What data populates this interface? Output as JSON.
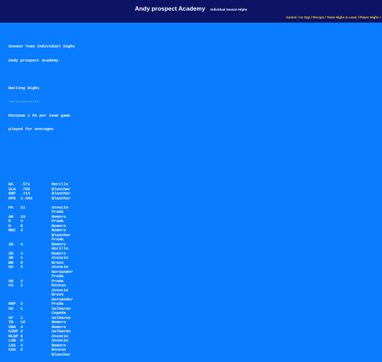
{
  "header": {
    "title": "Andy prospect Academy",
    "subtitle": "Individual Season Highs"
  },
  "nav": {
    "links": [
      "Games",
      "vs Opp",
      "Recaps",
      "Team Highs & Lows",
      "Player Highs"
    ],
    "separator": "/"
  },
  "content": {
    "heading1": "Season Team Individual Highs",
    "heading2": "Andy prospect Academy",
    "section": "Batting Highs",
    "underline": "-------------",
    "note1": "Minimum 1 PA per team game",
    "note2": "played for averages",
    "groups": [
      [
        {
          "stat": "BA",
          "value": ".571",
          "player": "Morillo"
        },
        {
          "stat": "SLG",
          "value": ".750",
          "player": "Blanchar"
        },
        {
          "stat": "OBP",
          "value": ".714",
          "player": "Blanchar"
        },
        {
          "stat": "OPS",
          "value": "1.464",
          "player": "Blanchar"
        }
      ],
      [
        {
          "stat": "PA",
          "value": "21",
          "player": "Atencio"
        },
        {
          "stat": "",
          "value": "",
          "player": "Prada"
        },
        {
          "stat": "AB",
          "value": "19",
          "player": "Romero"
        },
        {
          "stat": "R",
          "value": "4",
          "player": "Prada"
        },
        {
          "stat": "H",
          "value": "8",
          "player": "Romero"
        },
        {
          "stat": "RBI",
          "value": "3",
          "player": "Romero"
        },
        {
          "stat": "",
          "value": "",
          "player": "Blanchar"
        },
        {
          "stat": "",
          "value": "",
          "player": "Prada"
        },
        {
          "stat": "1B",
          "value": "4",
          "player": "Romero"
        },
        {
          "stat": "",
          "value": "",
          "player": "Morillo"
        },
        {
          "stat": "2B",
          "value": "4",
          "player": "Romero"
        },
        {
          "stat": "3B",
          "value": "1",
          "player": "Atencio"
        },
        {
          "stat": "BB",
          "value": "6",
          "player": "Bravo"
        },
        {
          "stat": "SO",
          "value": "5",
          "player": "Atencio"
        },
        {
          "stat": "",
          "value": "",
          "player": "Hernander"
        },
        {
          "stat": "",
          "value": "",
          "player": "Prada"
        },
        {
          "stat": "SB",
          "value": "2",
          "player": "Prada"
        },
        {
          "stat": "CS",
          "value": "1",
          "player": "Rincon"
        },
        {
          "stat": "",
          "value": "",
          "player": "Atencio"
        },
        {
          "stat": "",
          "value": "",
          "player": "Bravo"
        },
        {
          "stat": "",
          "value": "",
          "player": "Hernander"
        },
        {
          "stat": "HBP",
          "value": "3",
          "player": "Prada"
        },
        {
          "stat": "SH",
          "value": "1",
          "player": "Sulbaran"
        },
        {
          "stat": "",
          "value": "",
          "player": "Cepeda"
        },
        {
          "stat": "SF",
          "value": "1",
          "player": "Sulbaran"
        },
        {
          "stat": "TB",
          "value": "12",
          "player": "Romero"
        },
        {
          "stat": "XBH",
          "value": "4",
          "player": "Romero"
        },
        {
          "stat": "GIDP",
          "value": "2",
          "player": "Sulbaran"
        },
        {
          "stat": "RLSP",
          "value": "6",
          "player": "Atencio"
        },
        {
          "stat": "LOB",
          "value": "8",
          "player": "Atencio"
        },
        {
          "stat": "LHS",
          "value": "4",
          "player": "Romero"
        },
        {
          "stat": "CHS",
          "value": "2",
          "player": "Rincon"
        },
        {
          "stat": "",
          "value": "",
          "player": "Blanchar"
        }
      ]
    ]
  },
  "colors": {
    "background": "#0a7cff",
    "header_bg": "#0d1466",
    "nav_link": "#ffd12b",
    "text": "#ffffff"
  }
}
